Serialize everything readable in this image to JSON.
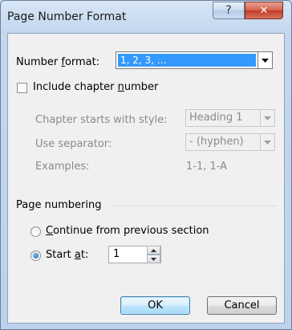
{
  "dialog": {
    "title": "Page Number Format",
    "help_label": "?",
    "close_label": "✕"
  },
  "number_format": {
    "label_before": "Number ",
    "label_mnemonic": "f",
    "label_after": "ormat:",
    "value": "1, 2, 3, …"
  },
  "include_chapter": {
    "label_before": "Include chapter ",
    "label_mnemonic": "n",
    "label_after": "umber",
    "checked": false
  },
  "chapter_style": {
    "label": "Chapter starts with style:",
    "value": "Heading 1"
  },
  "separator": {
    "label": "Use separator:",
    "value": "-  (hyphen)"
  },
  "examples": {
    "label": "Examples:",
    "value": "1-1, 1-A"
  },
  "page_numbering": {
    "group_label": "Page numbering",
    "continue": {
      "label_mnemonic": "C",
      "label_after": "ontinue from previous section",
      "selected": false
    },
    "start_at": {
      "label_before": "Start ",
      "label_mnemonic": "a",
      "label_after": "t:",
      "selected": true,
      "value": "1"
    }
  },
  "buttons": {
    "ok": "OK",
    "cancel": "Cancel"
  },
  "colors": {
    "selected_field": "#3399ff",
    "selected_text": "#ffffff"
  }
}
